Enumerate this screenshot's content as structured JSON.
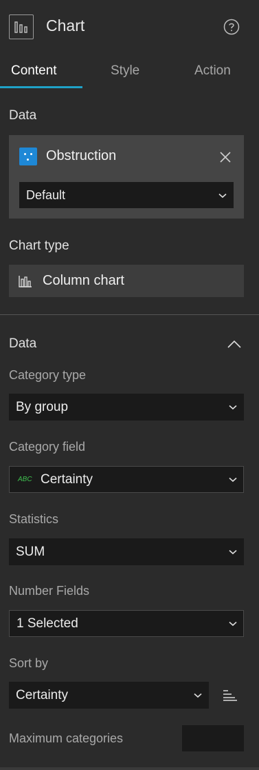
{
  "header": {
    "title": "Chart",
    "icon": "column-chart-icon",
    "help_icon": "help-circle-icon"
  },
  "tabs": [
    {
      "label": "Content",
      "active": true
    },
    {
      "label": "Style",
      "active": false
    },
    {
      "label": "Action",
      "active": false
    }
  ],
  "data_section": {
    "label": "Data",
    "datasource": {
      "name": "Obstruction",
      "icon": "point-layer-icon",
      "view_value": "Default"
    }
  },
  "chart_type": {
    "label": "Chart type",
    "value": "Column chart",
    "icon": "column-chart-icon"
  },
  "data_panel": {
    "label": "Data",
    "category_type": {
      "label": "Category type",
      "value": "By group"
    },
    "category_field": {
      "label": "Category field",
      "value": "Certainty",
      "field_type": "ABC"
    },
    "statistics": {
      "label": "Statistics",
      "value": "SUM"
    },
    "number_fields": {
      "label": "Number Fields",
      "value": "1 Selected"
    },
    "sort_by": {
      "label": "Sort by",
      "value": "Certainty",
      "order_icon": "sort-descending-icon"
    },
    "max_categories": {
      "label": "Maximum categories",
      "value": ""
    }
  },
  "colors": {
    "accent": "#1fa2c8",
    "field_type_green": "#3fbf4f",
    "layer_icon_blue": "#1e88d6"
  }
}
